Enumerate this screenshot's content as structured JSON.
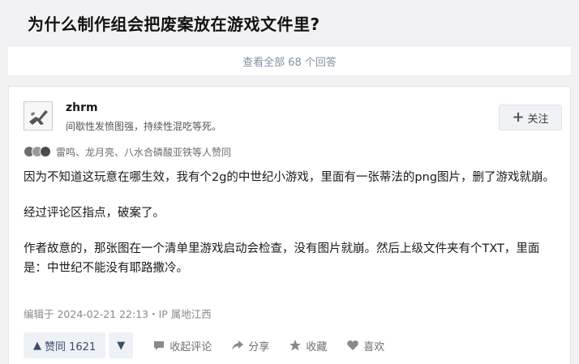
{
  "question": {
    "title": "为什么制作组会把废案放在游戏文件里?"
  },
  "view_all": {
    "label": "查看全部 68 个回答"
  },
  "answer": {
    "author": {
      "name": "zhrm",
      "bio": "间歇性发愤图强，持续性混吃等死。"
    },
    "follow_label": "关注",
    "likers_text": "雷鸣、龙月亮、八水合磷酸亚铁等人赞同",
    "paragraphs": [
      "因为不知道这玩意在哪生效，我有个2g的中世纪小游戏，里面有一张蒂法的png图片，删了游戏就崩。",
      "经过评论区指点，破案了。",
      "作者故意的，那张图在一个清单里游戏启动会检查，没有图片就崩。然后上级文件夹有个TXT，里面是：中世纪不能没有耶路撒冷。"
    ],
    "meta": "编辑于 2024-02-21 22:13・IP 属地江西",
    "vote_up_label": "赞同 1621",
    "actions": {
      "comment": "收起评论",
      "share": "分享",
      "collect": "收藏",
      "like": "喜欢"
    }
  }
}
